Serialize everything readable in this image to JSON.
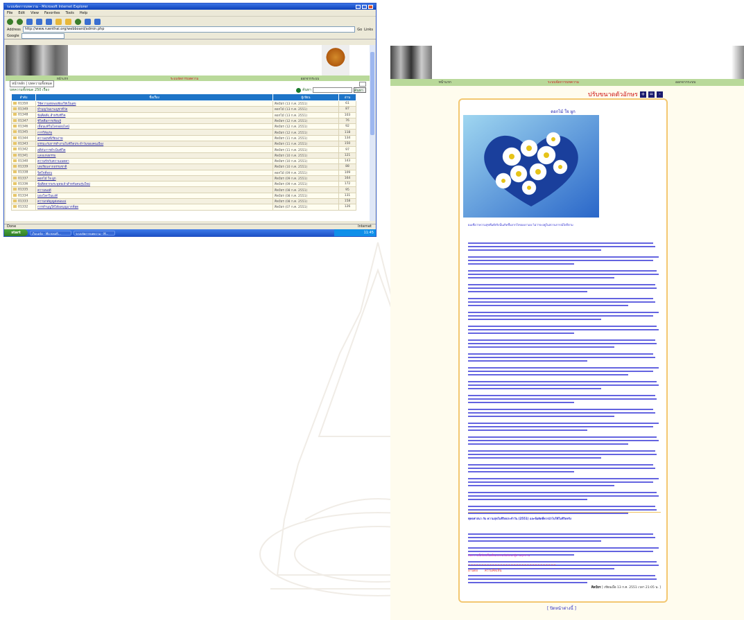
{
  "left_window": {
    "title": "ระบบจัดการบทความ - Microsoft Internet Explorer",
    "menus": [
      "File",
      "Edit",
      "View",
      "Favorites",
      "Tools",
      "Help"
    ],
    "address_label": "Address",
    "address_value": "http://www.ruenthai.org/webboard/admin.php",
    "go_label": "Go",
    "links_label": "Links",
    "google_label": "Google",
    "status_left": "Done",
    "status_right": "Internet",
    "start_label": "start",
    "tasks": [
      "เว็บบอร์ด - Microsoft...",
      "ระบบจัดการบทความ - M..."
    ],
    "clock": "11:45",
    "nav": [
      "หน้าแรก",
      "ระบบจัดการบทความ",
      "ออกจากระบบ"
    ],
    "crumb": "หน้าหลัก | บทความทั้งหมด",
    "filter_text": "บทความทั้งหมด 250 เรื่อง",
    "search_label": "ค้นหา",
    "search_button": "ค้นหา",
    "columns": [
      "ลำดับ",
      "ชื่อเรื่อง",
      "ผู้เขียน",
      "อ่าน"
    ],
    "rows": [
      {
        "id": "01350",
        "title": "ใช้ความสุขพอเพียงให้เป็นสุข",
        "author": "ศิลป์ธร (13 ก.ค. 2551)",
        "views": "61"
      },
      {
        "id": "01349",
        "title": "ทำบุญวันมาฆบูชาที่วัด",
        "author": "ดอกไม้ (13 ก.ค. 2551)",
        "views": "87"
      },
      {
        "id": "01348",
        "title": "ข้อคิดดีๆ สำหรับชีวิต",
        "author": "ดอกไม้ (13 ก.ค. 2551)",
        "views": "103"
      },
      {
        "id": "01347",
        "title": "ชีวิตคือการเรียนรู้",
        "author": "ศิลป์ธร (12 ก.ค. 2551)",
        "views": "76"
      },
      {
        "id": "01346",
        "title": "เพื่อนแท้ในโลกออนไลน์",
        "author": "ศิลป์ธร (12 ก.ค. 2551)",
        "views": "92"
      },
      {
        "id": "01345",
        "title": "การให้อภัย",
        "author": "ศิลป์ธร (12 ก.ค. 2551)",
        "views": "118"
      },
      {
        "id": "01344",
        "title": "ความสุขที่เรียบง่าย",
        "author": "ศิลป์ธร (11 ก.ค. 2551)",
        "views": "134"
      },
      {
        "id": "01343",
        "title": "ธรรมะกับการทำงานในชีวิตประจำวันของคนเมือง",
        "author": "ศิลป์ธร (11 ก.ค. 2551)",
        "views": "150"
      },
      {
        "id": "01342",
        "title": "สติกับการดำเนินชีวิต",
        "author": "ศิลป์ธร (11 ก.ค. 2551)",
        "views": "97"
      },
      {
        "id": "01341",
        "title": "แสงแห่งธรรม",
        "author": "ศิลป์ธร (10 ก.ค. 2551)",
        "views": "121"
      },
      {
        "id": "01340",
        "title": "ความรักกับความเมตตา",
        "author": "ศิลป์ธร (10 ก.ค. 2551)",
        "views": "143"
      },
      {
        "id": "01339",
        "title": "บทเรียนจากธรรมชาติ",
        "author": "ศิลป์ธร (10 ก.ค. 2551)",
        "views": "88"
      },
      {
        "id": "01338",
        "title": "จิตใจที่สงบ",
        "author": "ดอกไม้ (09 ก.ค. 2551)",
        "views": "109"
      },
      {
        "id": "01337",
        "title": "ดอกไม้ ใจ ผูก",
        "author": "ศิลป์ธร (09 ก.ค. 2551)",
        "views": "164"
      },
      {
        "id": "01336",
        "title": "ข้อคิดจากพระพุทธเจ้าสำหรับคนรุ่นใหม่",
        "author": "ศิลป์ธร (09 ก.ค. 2551)",
        "views": "172"
      },
      {
        "id": "01335",
        "title": "ความพอดี",
        "author": "ศิลป์ธร (08 ก.ค. 2551)",
        "views": "95"
      },
      {
        "id": "01334",
        "title": "มองโลกในแง่ดี",
        "author": "ศิลป์ธร (08 ก.ค. 2551)",
        "views": "131"
      },
      {
        "id": "01333",
        "title": "ความกตัญญูต่อพ่อแม่",
        "author": "ศิลป์ธร (08 ก.ค. 2551)",
        "views": "158"
      },
      {
        "id": "01332",
        "title": "การทำบุญให้ได้ผลบุญมากที่สุด",
        "author": "ศิลป์ธร (07 ก.ค. 2551)",
        "views": "126"
      }
    ]
  },
  "right_site": {
    "nav": [
      "หน้าแรก",
      "ระบบจัดการบทความ",
      "ออกจากระบบ"
    ],
    "page_title": "ปรับขนาดตัวอักษร",
    "size_buttons": [
      "+",
      "=",
      "-"
    ],
    "author_line": "ดอกไม้ ใจ ผูก",
    "intro": "ผมเชื่อว่าความสุขที่แท้จริงนั้นเกิดขึ้นจากใจของเราเอง ไม่ว่าจะอยู่ในสถานการณ์ใดก็ตาม",
    "highlight_heading": "พุทธศาสนา กับ ความสุขในชีวิตประจำวัน (2551) และข้อคิดที่ควรนำไปใช้ในชีวิตจริง",
    "pink_line": "บทความนี้เขียนขึ้นเพื่อแบ่งปันข้อคิดแก่ผู้อ่านทุกท่าน",
    "red_line": "=================================",
    "ref_links": [
      "อ่านต่อ",
      "ความคิดเห็น"
    ],
    "byline_name": "ศิลป์ธร",
    "byline_date": "[ เขียนเมื่อ 13 ก.ค. 2551 เวลา 21:05 น. ]",
    "close_link": "[ ปิดหน้าต่างนี้ ]",
    "colors": {
      "nav": "#b9d99a",
      "card_border": "#f3c770",
      "text": "#2a2ad0",
      "title": "#cc1010"
    }
  }
}
